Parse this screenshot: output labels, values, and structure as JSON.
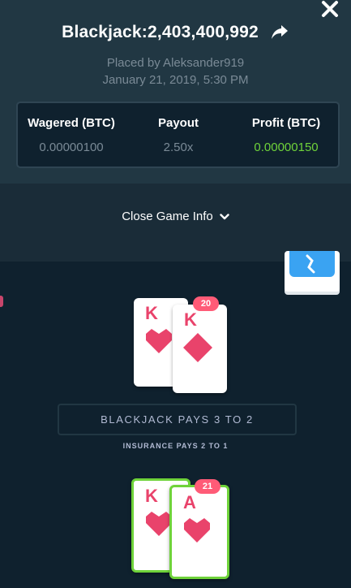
{
  "header": {
    "title": "Blackjack:2,403,400,992",
    "placed_by": "Placed by Aleksander919",
    "date": "January 21, 2019, 5:30 PM",
    "close_icon": "close-icon",
    "share_icon": "share-arrow-icon"
  },
  "stats": {
    "wagered_label": "Wagered (BTC)",
    "wagered_value": "0.00000100",
    "payout_label": "Payout",
    "payout_value": "2.50x",
    "profit_label": "Profit (BTC)",
    "profit_value": "0.00000150",
    "profit_color": "#6fd33a"
  },
  "toggle": {
    "label": "Close Game Info",
    "icon": "chevron-down-icon"
  },
  "dealer": {
    "score": "20",
    "cards": [
      {
        "rank": "K",
        "suit": "hearts"
      },
      {
        "rank": "K",
        "suit": "diamonds"
      }
    ]
  },
  "player": {
    "score": "21",
    "cards": [
      {
        "rank": "K",
        "suit": "hearts"
      },
      {
        "rank": "A",
        "suit": "hearts"
      }
    ]
  },
  "table_text": {
    "blackjack_pays": "BLACKJACK PAYS 3 TO 2",
    "insurance_pays": "INSURANCE PAYS 2 TO 1"
  },
  "colors": {
    "card_red": "#e9436b",
    "score_badge": "#ff5b77",
    "win_border": "#6fd33a"
  }
}
